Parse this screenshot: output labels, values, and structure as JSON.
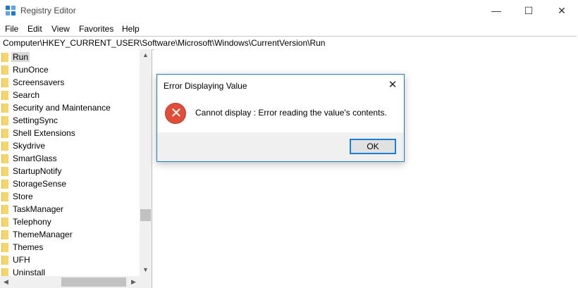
{
  "window": {
    "title": "Registry Editor",
    "icon": "registry-icon",
    "controls": {
      "minimize": "—",
      "maximize": "☐",
      "close": "✕"
    }
  },
  "menu": [
    "File",
    "Edit",
    "View",
    "Favorites",
    "Help"
  ],
  "address": "Computer\\HKEY_CURRENT_USER\\Software\\Microsoft\\Windows\\CurrentVersion\\Run",
  "tree": {
    "selected": "Run",
    "items": [
      "Run",
      "RunOnce",
      "Screensavers",
      "Search",
      "Security and Maintenance",
      "SettingSync",
      "Shell Extensions",
      "Skydrive",
      "SmartGlass",
      "StartupNotify",
      "StorageSense",
      "Store",
      "TaskManager",
      "Telephony",
      "ThemeManager",
      "Themes",
      "UFH",
      "Uninstall"
    ]
  },
  "dialog": {
    "title": "Error Displaying Value",
    "message": "Cannot display :  Error reading the value's contents.",
    "ok_label": "OK",
    "close_glyph": "✕",
    "error_glyph": "✕",
    "accent_color": "#1a7fd4",
    "error_color": "#e04e3a"
  },
  "scroll": {
    "up": "▲",
    "down": "▼",
    "left": "◀",
    "right": "▶"
  }
}
